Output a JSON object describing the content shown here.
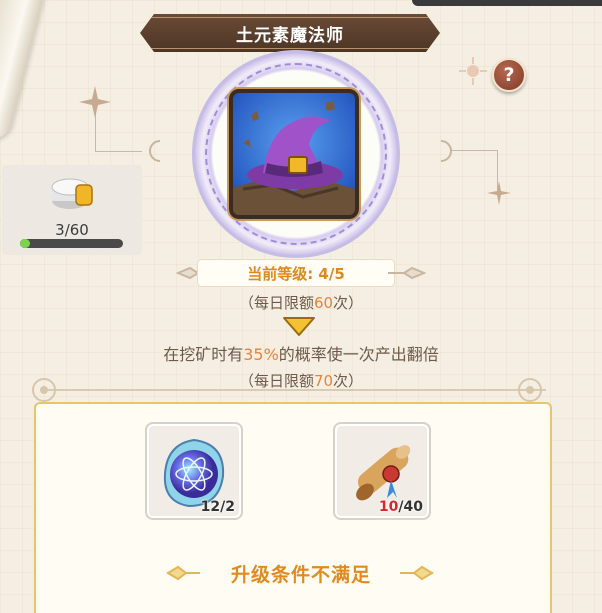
{
  "header": {
    "title": "土元素魔法师",
    "help_label": "?"
  },
  "resource": {
    "icon": "coin-stack-icon",
    "count": "3/60",
    "progress": 0.05
  },
  "skill": {
    "icon": "wizard-hat-icon",
    "level_text": "当前等级: 4/5"
  },
  "current_limit": {
    "prefix": "（每日限额",
    "value": "60",
    "suffix": "次）"
  },
  "next_effect": {
    "prefix": "在挖矿时有",
    "value": "35%",
    "suffix": "的概率使一次产出翻倍",
    "limit_prefix": "（每日限额",
    "limit_value": "70",
    "limit_suffix": "次）"
  },
  "requirements": [
    {
      "name": "atom-orb-icon",
      "have": "12",
      "need": "/2"
    },
    {
      "name": "scroll-icon",
      "have": "10",
      "need": "/40"
    }
  ],
  "condition_text": "升级条件不满足",
  "colors": {
    "accent": "#e08a20",
    "highlight": "#e8833a",
    "insufficient": "#d8262c",
    "banner": "#5a3e2c"
  }
}
